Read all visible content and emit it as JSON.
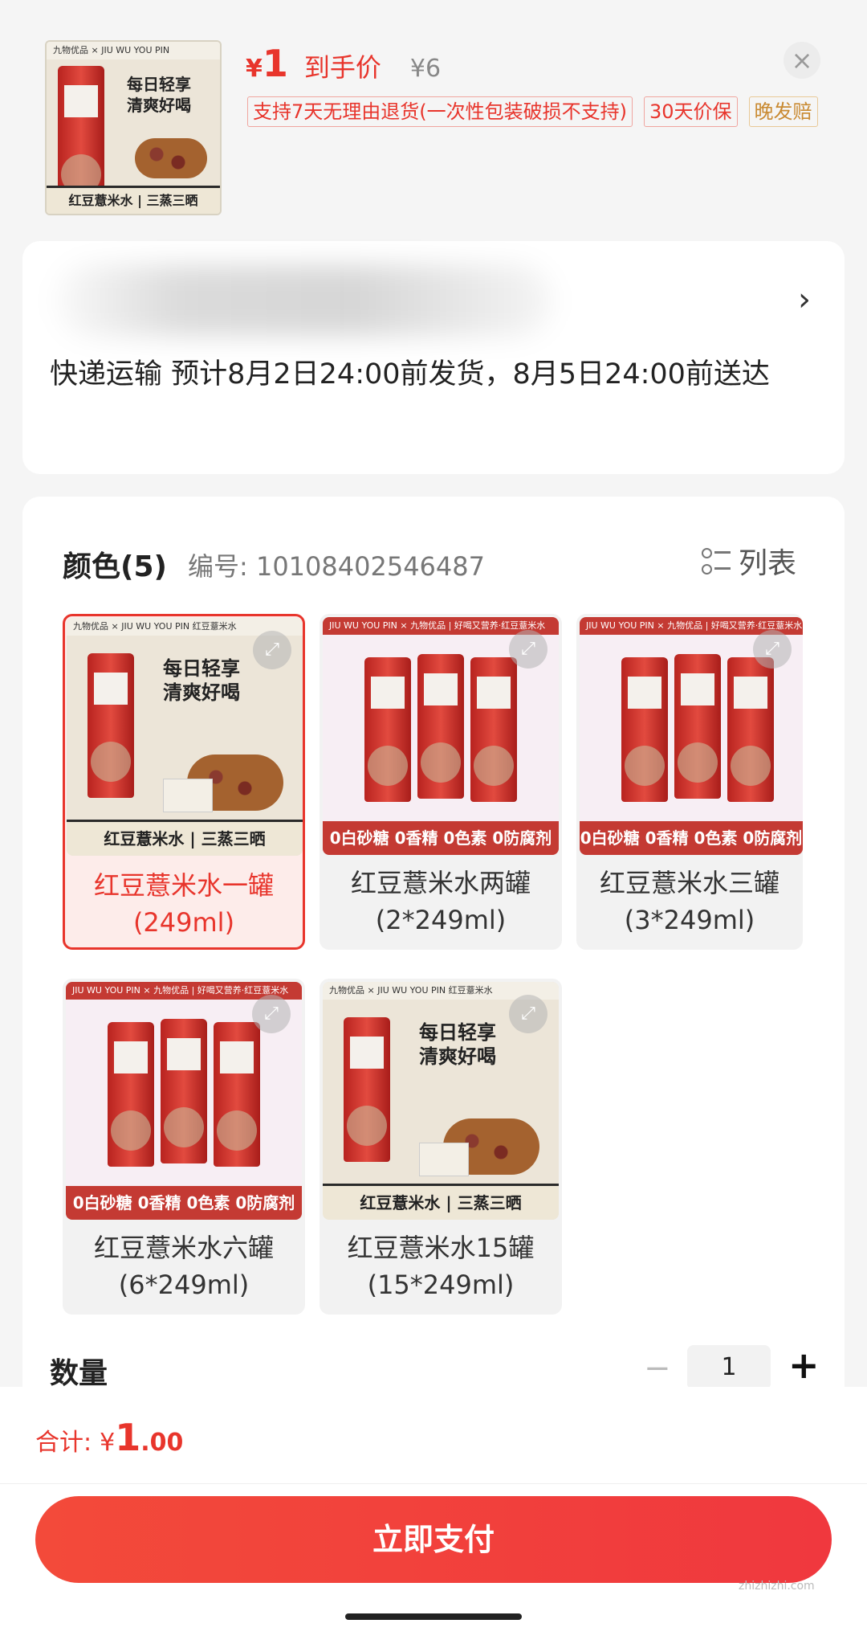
{
  "header": {
    "price_symbol": "¥",
    "price_value": "1",
    "price_label": "到手价",
    "original_price": "¥6",
    "tags": [
      "支持7天无理由退货(一次性包装破损不支持)",
      "30天价保",
      "晚发赔"
    ],
    "close_icon": "×"
  },
  "thumb": {
    "brand": "九物优品 × JIU WU YOU PIN",
    "product": "红豆薏米水",
    "slogan_line1": "每日轻享",
    "slogan_line2": "清爽好喝",
    "banner": "红豆薏米水 | 三蒸三晒"
  },
  "address": {
    "arrow": "›",
    "delivery_text": "快递运输 预计8月2日24:00前发货，8月5日24:00前送达"
  },
  "spec": {
    "title": "颜色(5)",
    "code": "编号: 10108402546487",
    "list_label": "列表",
    "options": [
      {
        "name": "红豆薏米水一罐\n(249ml)",
        "line1": "红豆薏米水一罐",
        "line2": "(249ml)",
        "selected": true,
        "style": "single",
        "banner": "红豆薏米水 | 三蒸三晒",
        "topbar": "九物优品 × JIU WU YOU PIN    红豆薏米水"
      },
      {
        "line1": "红豆薏米水两罐",
        "line2": "(2*249ml)",
        "selected": false,
        "style": "multi",
        "banner": "0白砂糖 0香精 0色素 0防腐剂",
        "topbar": "JIU WU YOU PIN × 九物优品 | 好喝又营养·红豆薏米水"
      },
      {
        "line1": "红豆薏米水三罐",
        "line2": "(3*249ml)",
        "selected": false,
        "style": "multi",
        "banner": "0白砂糖 0香精 0色素 0防腐剂",
        "topbar": "JIU WU YOU PIN × 九物优品 | 好喝又营养·红豆薏米水"
      },
      {
        "line1": "红豆薏米水六罐",
        "line2": "(6*249ml)",
        "selected": false,
        "style": "multi",
        "banner": "0白砂糖 0香精 0色素 0防腐剂",
        "topbar": "JIU WU YOU PIN × 九物优品 | 好喝又营养·红豆薏米水"
      },
      {
        "line1": "红豆薏米水15罐",
        "line2": "(15*249ml)",
        "selected": false,
        "style": "single",
        "banner": "红豆薏米水 | 三蒸三晒",
        "topbar": "九物优品 × JIU WU YOU PIN    红豆薏米水"
      }
    ]
  },
  "quantity": {
    "label": "数量",
    "minus": "−",
    "value": "1",
    "plus": "+"
  },
  "footer": {
    "total_label": "合计:",
    "total_symbol": "¥",
    "total_int": "1",
    "total_dec": ".00",
    "pay_button": "立即支付",
    "watermark": "zhizhizhi.com"
  },
  "colors": {
    "accent": "#e8352c",
    "gold": "#c98a32"
  }
}
